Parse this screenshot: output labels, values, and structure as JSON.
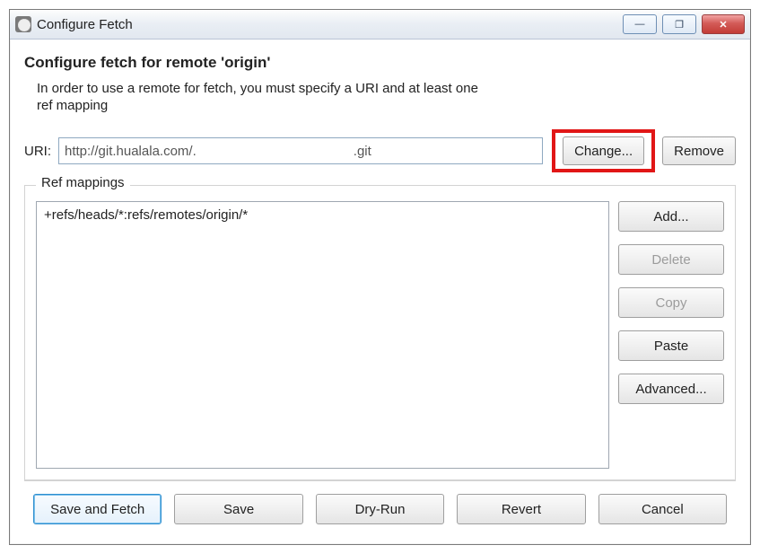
{
  "title": "Configure Fetch",
  "heading": "Configure fetch for remote 'origin'",
  "description1": "In order to use a remote for fetch, you must specify a URI and at least one",
  "description2": "ref mapping",
  "uri_label": "URI:",
  "uri_value": "http://git.hualala.com/.                                          .git",
  "buttons": {
    "change": "Change...",
    "remove": "Remove",
    "add": "Add...",
    "delete": "Delete",
    "copy": "Copy",
    "paste": "Paste",
    "advanced": "Advanced..."
  },
  "ref_mappings_label": "Ref mappings",
  "ref_mappings": "+refs/heads/*:refs/remotes/origin/*",
  "footer": {
    "save_fetch": "Save and Fetch",
    "save": "Save",
    "dry_run": "Dry-Run",
    "revert": "Revert",
    "cancel": "Cancel"
  },
  "win_controls": {
    "minimize": "—",
    "maximize": "❐",
    "close": "✕"
  }
}
